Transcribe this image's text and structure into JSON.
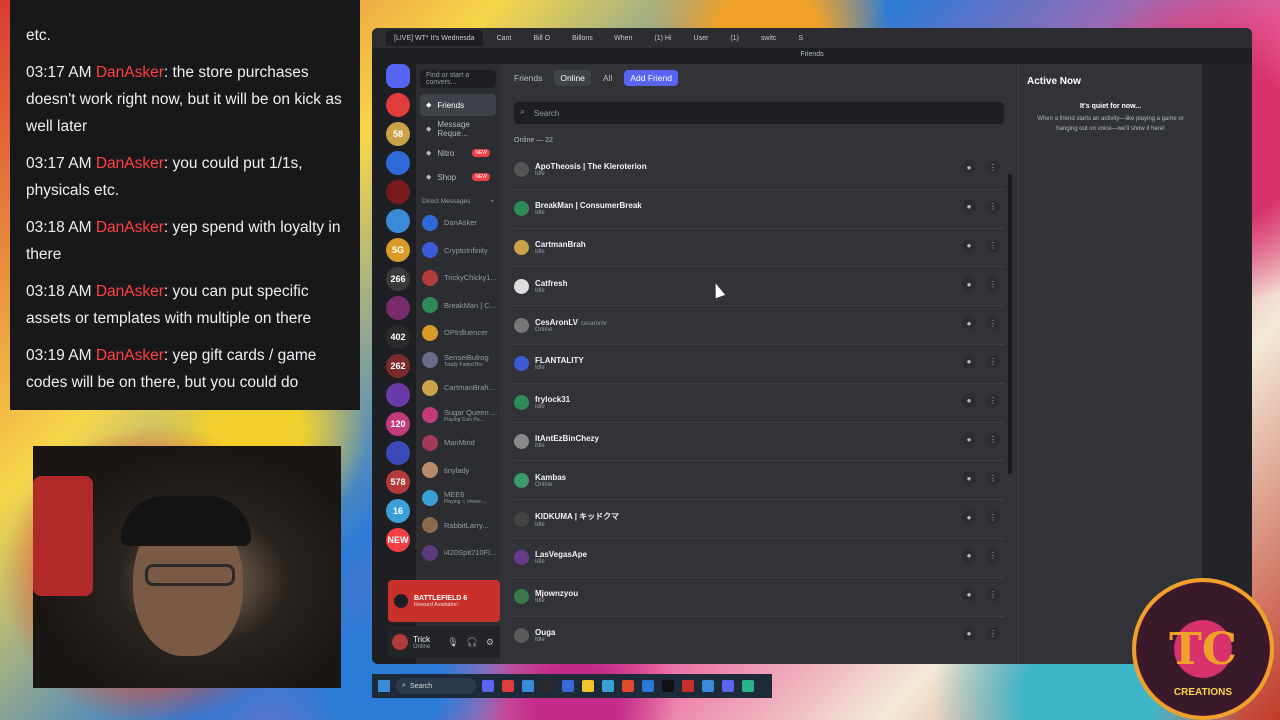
{
  "chat": {
    "lines": [
      {
        "time": "",
        "user": "",
        "text": "etc."
      },
      {
        "time": "03:17 AM",
        "user": "DanAsker",
        "text": ": the store purchases doesn't work right now, but it will be on kick as well later"
      },
      {
        "time": "03:17 AM",
        "user": "DanAsker",
        "text": ": you could put 1/1s, physicals etc."
      },
      {
        "time": "03:18 AM",
        "user": "DanAsker",
        "text": ": yep spend with loyalty in there"
      },
      {
        "time": "03:18 AM",
        "user": "DanAsker",
        "text": ": you can put specific assets or templates with multiple on there"
      },
      {
        "time": "03:19 AM",
        "user": "DanAsker",
        "text": ": yep gift cards / game codes will be on there, but you could do"
      }
    ]
  },
  "browser": {
    "tabs": [
      "[LIVE] WT* It's Wednesda",
      "Cant",
      "Bill O",
      "Billons",
      "When",
      "(1) Hi",
      "User",
      "(1)",
      "switc",
      "S"
    ],
    "window_title": "Friends"
  },
  "discord": {
    "sidebar": {
      "search_placeholder": "Find or start a convers...",
      "nav": [
        {
          "label": "Friends",
          "icon": "friends-icon",
          "badge": ""
        },
        {
          "label": "Message Reque...",
          "icon": "inbox-icon",
          "badge": ""
        },
        {
          "label": "Nitro",
          "icon": "nitro-icon",
          "badge": "NEW"
        },
        {
          "label": "Shop",
          "icon": "shop-icon",
          "badge": "NEW"
        }
      ],
      "dm_header": "Direct Messages",
      "dm_add": "+",
      "dms": [
        {
          "name": "DanAsker",
          "sub": "",
          "color": "#2f6bd8"
        },
        {
          "name": "CryptoInfinity",
          "sub": "",
          "color": "#3b5bd6"
        },
        {
          "name": "TrickyChicky1...",
          "sub": "",
          "color": "#b33a3a"
        },
        {
          "name": "BreakMan | C...",
          "sub": "",
          "color": "#2e8b57"
        },
        {
          "name": "OPInfluencer",
          "sub": "",
          "color": "#d89b2a"
        },
        {
          "name": "SenseiBulrog",
          "sub": "Totally Faded Bro",
          "color": "#6a6a8a"
        },
        {
          "name": "CartmanBrah...",
          "sub": "",
          "color": "#c9a24a"
        },
        {
          "name": "Sugar Queen ...",
          "sub": "Playing Coin Pu...",
          "color": "#c23a7a"
        },
        {
          "name": "MariMind",
          "sub": "",
          "color": "#a33a5a"
        },
        {
          "name": "tinylady",
          "sub": "",
          "color": "#b88a6a"
        },
        {
          "name": "MEE6",
          "sub": "Playing ♫ /meee-...",
          "color": "#3aa0d8"
        },
        {
          "name": "RabbitLarry...",
          "sub": "",
          "color": "#8a6a4a"
        },
        {
          "name": "i420Spit710Fl...",
          "sub": "",
          "color": "#5a3a7a"
        }
      ],
      "promo_title": "BATTLEFIELD 6",
      "promo_sub": "Reward Available!",
      "user_name": "Trick",
      "user_status": "Online"
    },
    "servers": [
      "",
      "",
      "58",
      "",
      "",
      "",
      "5G",
      "266",
      "",
      "402",
      "262",
      "",
      "120",
      "",
      "578",
      "16",
      "NEW"
    ],
    "topnav": {
      "friends": "Friends",
      "online": "Online",
      "all": "All",
      "add": "Add Friend"
    },
    "search_placeholder": "Search",
    "online_count": "Online — 22",
    "friends": [
      {
        "name": "ApoTheosis | The Kleroterion",
        "tag": "",
        "status": "Idle",
        "color": "#555"
      },
      {
        "name": "BreakMan | ConsumerBreak",
        "tag": "",
        "status": "Idle",
        "color": "#2e8b57"
      },
      {
        "name": "CartmanBrah",
        "tag": "",
        "status": "Idle",
        "color": "#c9a24a"
      },
      {
        "name": "Catfresh",
        "tag": "",
        "status": "Idle",
        "color": "#ddd"
      },
      {
        "name": "CesAronLV",
        "tag": "cesaronlv",
        "status": "Online",
        "color": "#777"
      },
      {
        "name": "FLANTALITY",
        "tag": "",
        "status": "Idle",
        "color": "#3b5bd6"
      },
      {
        "name": "frylock31",
        "tag": "",
        "status": "Idle",
        "color": "#2e8b57"
      },
      {
        "name": "ItAntEzBinChezy",
        "tag": "",
        "status": "Idle",
        "color": "#888"
      },
      {
        "name": "Kambas",
        "tag": "",
        "status": "Online",
        "color": "#3a9a6a"
      },
      {
        "name": "KIDKUMA | キッドクマ",
        "tag": "",
        "status": "Idle",
        "color": "#444"
      },
      {
        "name": "LasVegasApe",
        "tag": "",
        "status": "Idle",
        "color": "#6a3a8a"
      },
      {
        "name": "Mjownzyou",
        "tag": "",
        "status": "Idle",
        "color": "#3a7a4a"
      },
      {
        "name": "Ouga",
        "tag": "",
        "status": "Idle",
        "color": "#5a5a5a"
      }
    ],
    "active_now": {
      "title": "Active Now",
      "quiet": "It's quiet for now...",
      "desc": "When a friend starts an activity—like playing a game or hanging out on voice—we'll show it here!"
    }
  },
  "taskbar": {
    "search": "Search"
  },
  "overlay_logo": {
    "initials": "TC",
    "text": "CREATIONS"
  }
}
